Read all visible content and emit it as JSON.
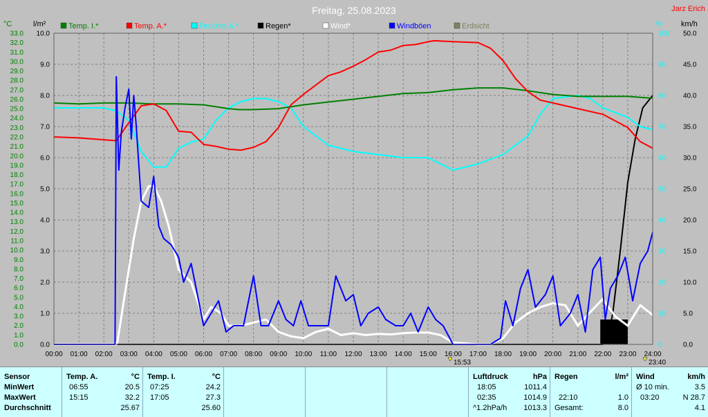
{
  "header": {
    "title": "Freitag, 25.08.2023",
    "station": "Jarz Erich",
    "unit_temp": "°C",
    "unit_rain": "l/m²",
    "unit_hum": "%",
    "unit_wind": "km/h"
  },
  "legend": [
    {
      "label": "Temp. I.*",
      "color": "#008000"
    },
    {
      "label": "Temp. A.*",
      "color": "#ff0000"
    },
    {
      "label": "Feuchte A.*",
      "color": "#00ffff"
    },
    {
      "label": "Regen*",
      "color": "#000000"
    },
    {
      "label": "Wind*",
      "color": "#ffffff"
    },
    {
      "label": "Windböen",
      "color": "#0000ff"
    },
    {
      "label": "Erdsicht",
      "color": "#808060"
    }
  ],
  "markers": {
    "left": "15:53",
    "right": "23:40"
  },
  "chart_data": {
    "type": "line",
    "x_unit": "hours",
    "xlim": [
      0,
      24
    ],
    "x_tick_labels": [
      "00:00",
      "01:00",
      "02:00",
      "03:00",
      "04:00",
      "05:00",
      "06:00",
      "07:00",
      "08:00",
      "09:00",
      "10:00",
      "11:00",
      "12:00",
      "13:00",
      "14:00",
      "15:00",
      "16:00",
      "17:00",
      "18:00",
      "19:00",
      "20:00",
      "21:00",
      "22:00",
      "23:00",
      "24:00"
    ],
    "axes": {
      "temp": {
        "label": "°C",
        "range": [
          0,
          33
        ],
        "ticks": [
          "0.0",
          "1.0",
          "2.0",
          "3.0",
          "4.0",
          "5.0",
          "6.0",
          "7.0",
          "8.0",
          "9.0",
          "10.0",
          "11.0",
          "12.0",
          "13.0",
          "14.0",
          "15.0",
          "16.0",
          "17.0",
          "18.0",
          "19.0",
          "20.0",
          "21.0",
          "22.0",
          "23.0",
          "24.0",
          "25.0",
          "26.0",
          "27.0",
          "28.0",
          "29.0",
          "30.0",
          "31.0",
          "32.0",
          "33.0"
        ]
      },
      "rain": {
        "label": "l/m²",
        "range": [
          0,
          10
        ],
        "ticks": [
          "0.0",
          "1.0",
          "2.0",
          "3.0",
          "4.0",
          "5.0",
          "6.0",
          "7.0",
          "8.0",
          "9.0",
          "10.0"
        ]
      },
      "hum": {
        "label": "%",
        "range": [
          0,
          100
        ],
        "ticks": [
          "0",
          "10",
          "20",
          "30",
          "40",
          "50",
          "60",
          "70",
          "80",
          "90",
          "100"
        ]
      },
      "wind": {
        "label": "km/h",
        "range": [
          0,
          50
        ],
        "ticks": [
          "0.0",
          "5.0",
          "10.0",
          "15.0",
          "20.0",
          "25.0",
          "30.0",
          "35.0",
          "40.0",
          "45.0",
          "50.0"
        ]
      }
    },
    "grid": true,
    "series": [
      {
        "name": "Temp. I.*",
        "axis": "temp",
        "color": "#008000",
        "x": [
          0,
          1,
          2,
          3,
          4,
          5,
          6,
          7,
          7.42,
          8,
          9,
          10,
          11,
          12,
          13,
          14,
          15,
          16,
          17,
          18,
          19,
          20,
          21,
          22,
          23,
          24
        ],
        "y": [
          25.6,
          25.5,
          25.6,
          25.6,
          25.5,
          25.5,
          25.4,
          25.0,
          24.9,
          24.9,
          25.0,
          25.4,
          25.7,
          26.0,
          26.3,
          26.6,
          26.7,
          27.0,
          27.2,
          27.2,
          26.9,
          26.5,
          26.3,
          26.3,
          26.3,
          26.1
        ]
      },
      {
        "name": "Temp. A.*",
        "axis": "temp",
        "color": "#ff0000",
        "x": [
          0,
          1,
          2,
          2.5,
          3,
          3.5,
          4,
          4.5,
          5,
          5.5,
          6,
          6.5,
          7,
          7.5,
          8,
          8.5,
          9,
          9.5,
          10,
          11,
          11.5,
          12,
          12.5,
          13,
          13.5,
          14,
          14.5,
          15,
          15.25,
          16,
          17,
          17.5,
          18,
          18.5,
          19,
          19.5,
          20,
          21,
          22,
          23,
          23.5,
          24
        ],
        "y": [
          22.0,
          21.9,
          21.7,
          21.6,
          23.5,
          25.3,
          25.5,
          24.8,
          22.6,
          22.5,
          21.2,
          21.0,
          20.7,
          20.6,
          20.9,
          21.5,
          23.0,
          25.4,
          26.5,
          28.5,
          28.9,
          29.5,
          30.2,
          31.0,
          31.2,
          31.7,
          31.8,
          32.1,
          32.2,
          32.1,
          32.0,
          31.4,
          30.1,
          28.2,
          26.8,
          25.9,
          25.6,
          25.0,
          24.4,
          23.0,
          21.5,
          20.8
        ]
      },
      {
        "name": "Feuchte A.*",
        "axis": "hum",
        "color": "#00ffff",
        "x": [
          0,
          1,
          2,
          2.5,
          3,
          3.5,
          4,
          4.5,
          5,
          5.5,
          6,
          6.5,
          7,
          7.5,
          8,
          8.5,
          9,
          9.5,
          10,
          11,
          12,
          13,
          14,
          15,
          16,
          17,
          18,
          19,
          19.5,
          20,
          21,
          21.5,
          22,
          23,
          23.5,
          24
        ],
        "y": [
          76,
          76,
          76,
          75,
          72,
          62,
          57,
          57,
          63,
          65,
          66,
          72,
          76,
          78,
          79,
          79,
          78,
          76,
          70,
          64,
          62,
          61,
          60,
          60,
          56,
          58,
          61,
          67,
          74,
          79,
          80,
          79,
          76,
          73,
          70,
          69
        ]
      },
      {
        "name": "Regen*",
        "axis": "rain",
        "color": "#000000",
        "x": [
          0,
          22.0,
          22.17,
          22.4,
          22.7,
          23.0,
          23.3,
          23.6,
          24
        ],
        "y": [
          0,
          0,
          0.1,
          1.0,
          3.0,
          5.2,
          6.6,
          7.6,
          8.0
        ]
      },
      {
        "name": "Wind*",
        "axis": "wind",
        "color": "#ffffff",
        "x": [
          0,
          2.5,
          2.55,
          2.8,
          3.0,
          3.2,
          3.5,
          3.8,
          4.0,
          4.3,
          4.6,
          5.0,
          5.5,
          6.0,
          6.3,
          6.7,
          7.0,
          7.5,
          8.0,
          8.5,
          9.0,
          9.5,
          10.0,
          10.5,
          11.0,
          11.5,
          12.0,
          12.5,
          13.0,
          13.5,
          14.0,
          14.5,
          15.0,
          15.5,
          16.0,
          17.0,
          17.5,
          18.0,
          18.5,
          19.0,
          19.5,
          20.0,
          20.5,
          21.0,
          21.5,
          22.0,
          22.5,
          23.0,
          23.5,
          24.0
        ],
        "y": [
          0,
          0,
          0.5,
          7,
          12,
          17,
          23,
          25.4,
          25.5,
          23,
          19,
          12,
          10,
          4,
          6,
          5,
          3,
          3,
          3.5,
          4,
          2,
          1.3,
          1.0,
          2,
          2.5,
          1.5,
          1.8,
          1.5,
          1.7,
          1.6,
          1.8,
          1.9,
          1.9,
          1.5,
          0.3,
          0,
          0,
          1,
          3.5,
          5,
          6,
          6.6,
          6.3,
          3,
          5.2,
          7.3,
          4.5,
          3,
          6.3,
          4.7
        ]
      },
      {
        "name": "Windböen",
        "axis": "wind",
        "color": "#0000ff",
        "x": [
          0,
          2.45,
          2.5,
          2.6,
          2.7,
          2.85,
          3.0,
          3.1,
          3.2,
          3.3,
          3.5,
          3.8,
          4.0,
          4.2,
          4.4,
          4.7,
          5.0,
          5.2,
          5.5,
          6.0,
          6.3,
          6.6,
          6.9,
          7.2,
          7.6,
          8.0,
          8.3,
          8.6,
          9.0,
          9.3,
          9.6,
          9.9,
          10.2,
          10.6,
          11.0,
          11.3,
          11.7,
          12.0,
          12.3,
          12.6,
          13.0,
          13.3,
          13.7,
          14.0,
          14.3,
          14.6,
          15.0,
          15.3,
          15.6,
          16.0,
          16.5,
          17.0,
          17.5,
          17.9,
          18.1,
          18.4,
          18.7,
          19.0,
          19.3,
          19.7,
          20.0,
          20.3,
          20.7,
          21.0,
          21.3,
          21.6,
          21.9,
          22.1,
          22.3,
          22.6,
          22.9,
          23.2,
          23.5,
          23.8,
          24.0
        ],
        "y": [
          0,
          0,
          43,
          28,
          34,
          38,
          41,
          33,
          40,
          35,
          23,
          22,
          27,
          19,
          17,
          16,
          14,
          10,
          13,
          3,
          5,
          7,
          2,
          3,
          3,
          11,
          3,
          3,
          7,
          4,
          3,
          7,
          3,
          3,
          3,
          11,
          7,
          8,
          3,
          5,
          6,
          4,
          3,
          3,
          5,
          2,
          6,
          4,
          3,
          0,
          0,
          0,
          0,
          1,
          7,
          3,
          9,
          12,
          6,
          8,
          11,
          3,
          5,
          8,
          2,
          12,
          14,
          4,
          9,
          11,
          14,
          7,
          13,
          15,
          18
        ]
      }
    ]
  },
  "stats": {
    "sensor_header": "Sensor",
    "row_labels": [
      "MinWert",
      "MaxWert",
      "Durchschnitt"
    ],
    "temp_a": {
      "header": "Temp. A.",
      "unit": "°C",
      "min_time": "06:55",
      "min_val": "20.5",
      "max_time": "15:15",
      "max_val": "32.2",
      "avg": "25.67"
    },
    "temp_i": {
      "header": "Temp. I.",
      "unit": "°C",
      "min_time": "07:25",
      "min_val": "24.2",
      "max_time": "17:05",
      "max_val": "27.3",
      "avg": "25.60"
    },
    "pressure": {
      "header": "Luftdruck",
      "unit": "hPa",
      "min_time": "18:05",
      "min_val": "1011.4",
      "max_time": "02:35",
      "max_val": "1014.9",
      "trend": "^1.2hPa/h",
      "avg": "1013.3"
    },
    "rain": {
      "header": "Regen",
      "unit": "l/m²",
      "max_time": "22:10",
      "max_val": "1.0",
      "total_label": "Gesamt:",
      "total": "8.0"
    },
    "wind": {
      "header": "Wind",
      "unit": "km/h",
      "min_label": "Ø 10 min.",
      "min_val": "3.5",
      "max_time": "03:20",
      "max_val": "N 28.7",
      "avg": "4.1"
    }
  }
}
